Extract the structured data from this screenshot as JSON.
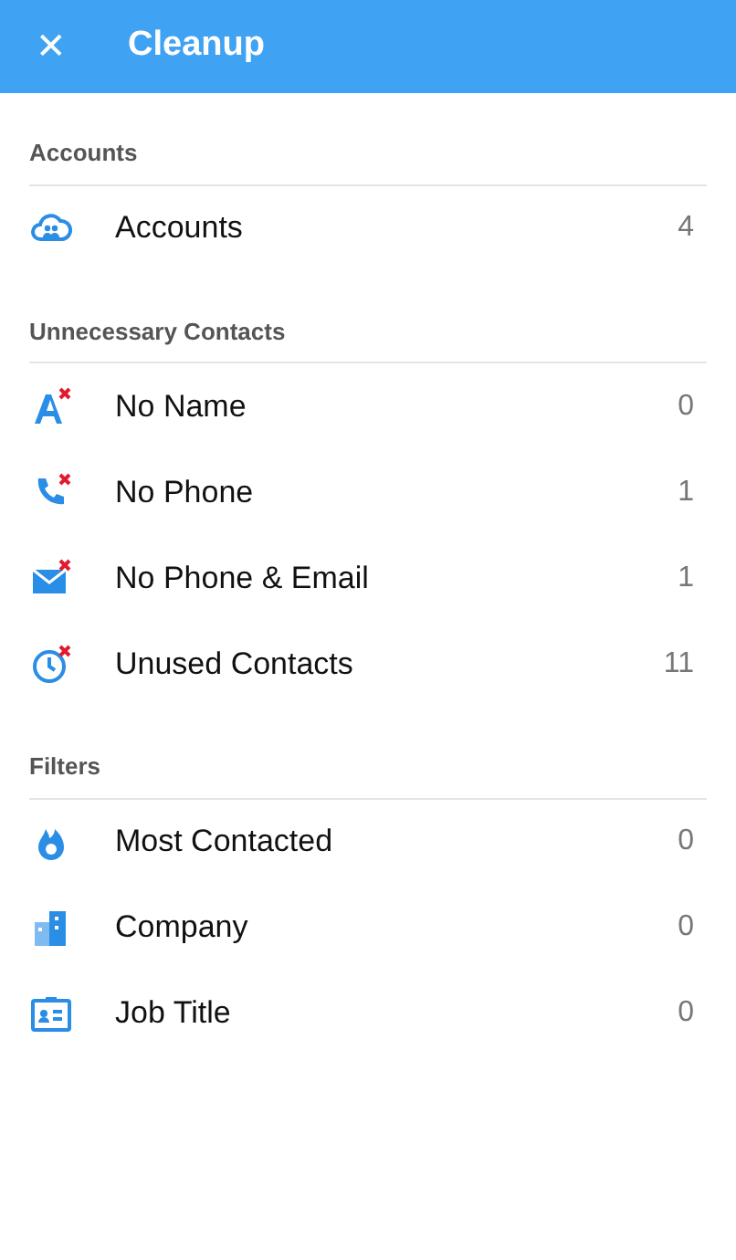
{
  "app_bar": {
    "close": "✕",
    "title": "Cleanup"
  },
  "sections": [
    {
      "heading": "Accounts",
      "items": [
        {
          "label": "Accounts",
          "count": "4"
        }
      ]
    },
    {
      "heading": "Unnecessary Contacts",
      "items": [
        {
          "label": "No Name",
          "count": "0"
        },
        {
          "label": "No Phone",
          "count": "1"
        },
        {
          "label": "No Phone & Email",
          "count": "1"
        },
        {
          "label": "Unused Contacts",
          "count": "11"
        }
      ]
    },
    {
      "heading": "Filters",
      "items": [
        {
          "label": "Most Contacted",
          "count": "0"
        },
        {
          "label": "Company",
          "count": "0"
        },
        {
          "label": "Job Title",
          "count": "0"
        }
      ]
    }
  ]
}
